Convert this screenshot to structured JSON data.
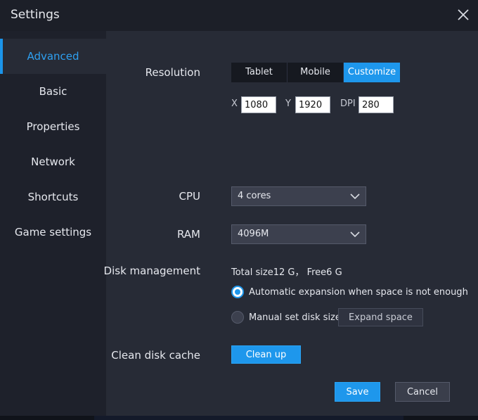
{
  "window": {
    "title": "Settings"
  },
  "sidebar": {
    "items": [
      {
        "label": "Advanced",
        "active": true
      },
      {
        "label": "Basic"
      },
      {
        "label": "Properties"
      },
      {
        "label": "Network"
      },
      {
        "label": "Shortcuts"
      },
      {
        "label": "Game settings"
      }
    ]
  },
  "resolution": {
    "label": "Resolution",
    "options": [
      "Tablet",
      "Mobile",
      "Customize"
    ],
    "selected": "Customize",
    "x_label": "X",
    "x_value": "1080",
    "y_label": "Y",
    "y_value": "1920",
    "dpi_label": "DPI",
    "dpi_value": "280"
  },
  "cpu": {
    "label": "CPU",
    "value": "4 cores"
  },
  "ram": {
    "label": "RAM",
    "value": "4096M"
  },
  "disk": {
    "label": "Disk management",
    "info": "Total size12 G， Free6 G",
    "auto_label": "Automatic expansion when space is not enough",
    "manual_label": "Manual set disk size",
    "expand_label": "Expand space",
    "selected": "auto"
  },
  "cache": {
    "label": "Clean disk cache",
    "button": "Clean up"
  },
  "footer": {
    "save": "Save",
    "cancel": "Cancel"
  },
  "colors": {
    "accent": "#1e97ec",
    "panel": "#272b36",
    "sidebar": "#1e212b"
  },
  "icons": {
    "close": "close-icon",
    "dropdown": "chevron-down-icon"
  }
}
